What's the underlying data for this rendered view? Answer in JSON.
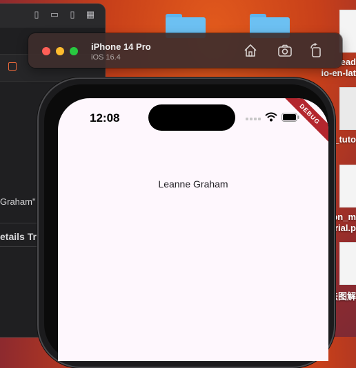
{
  "ide": {
    "partial_text_1": "Graham\"",
    "partial_text_2": "etails Tre"
  },
  "desktop": {
    "right_labels": [
      "ead",
      "io-en-lat",
      "y_tuto",
      "on_m",
      "rial.p",
      "法图解"
    ]
  },
  "simulator": {
    "device_name": "iPhone 14 Pro",
    "os_version": "iOS 16.4",
    "buttons": [
      "home-icon",
      "screenshot-icon",
      "rotate-icon"
    ]
  },
  "phone": {
    "status_time": "12:08",
    "debug_banner": "DEBUG",
    "content_text": "Leanne Graham"
  }
}
